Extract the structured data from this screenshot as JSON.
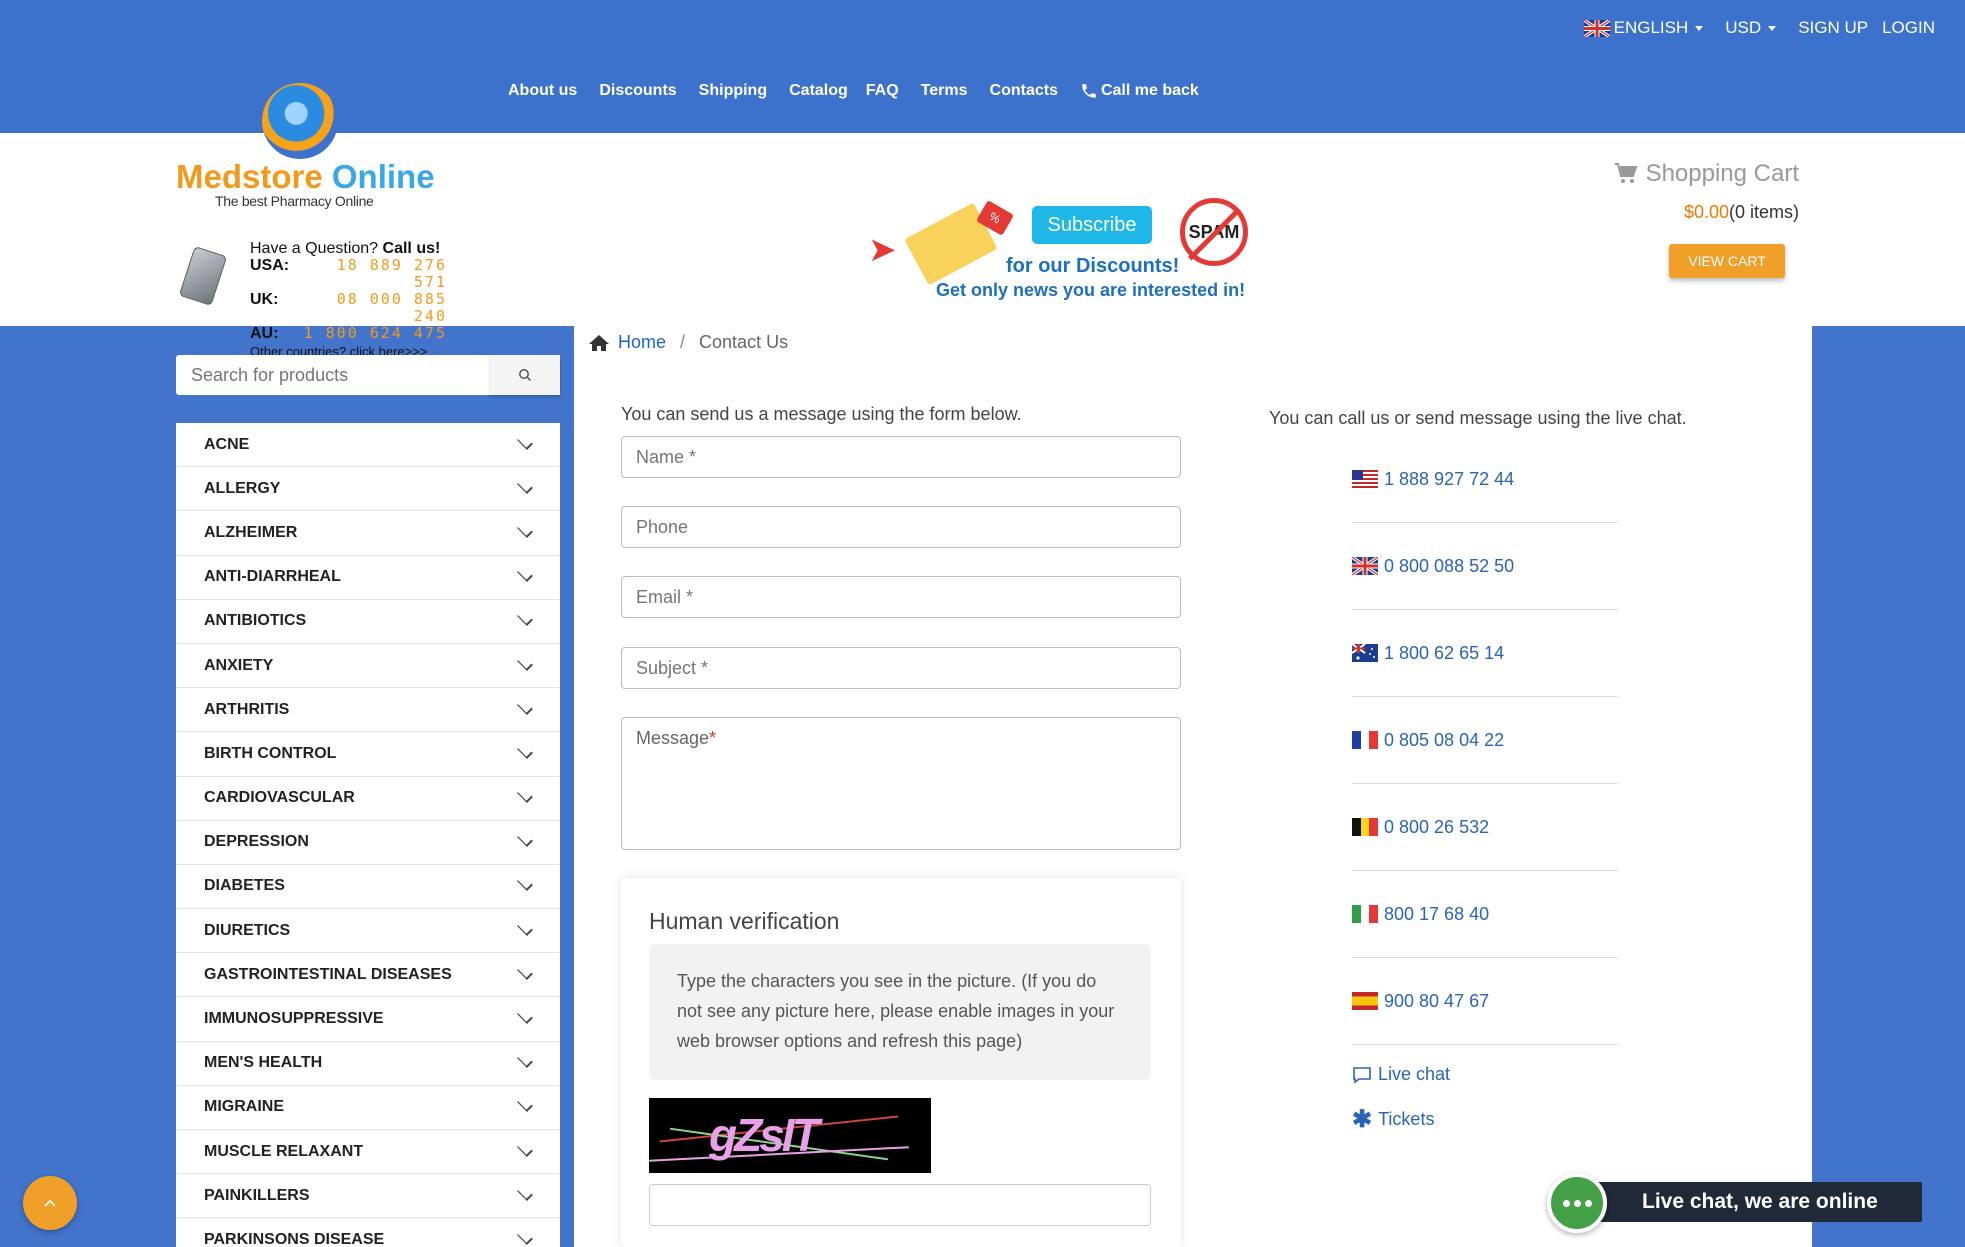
{
  "toplinks": {
    "language": "ENGLISH",
    "currency": "USD",
    "signup": "SIGN UP",
    "login": "LOGIN"
  },
  "nav": [
    "About us",
    "Discounts",
    "Shipping",
    "Catalog",
    "FAQ",
    "Terms",
    "Contacts",
    "Call me back"
  ],
  "logo": {
    "part1": "Medstore",
    "part2": "Online",
    "tagline": "The best Pharmacy Online"
  },
  "callus": {
    "question": "Have a Question?",
    "callus": "Call us!",
    "rows": [
      {
        "label": "USA:",
        "number": "18 889 276 571"
      },
      {
        "label": "UK:",
        "number": "08 000 885 240"
      },
      {
        "label": "AU:",
        "number": "1 800 624 475"
      }
    ],
    "other": "Other countries? click here>>>"
  },
  "subscribe": {
    "button": "Subscribe",
    "spam": "SPAM",
    "line1": "for our Discounts!",
    "line2": "Get only news you are interested in!",
    "tag": "%"
  },
  "cart": {
    "title": "Shopping Cart",
    "amount": "$0.00",
    "items": "(0 items)",
    "view": "VIEW CART"
  },
  "search": {
    "placeholder": "Search for products"
  },
  "categories": [
    "ACNE",
    "ALLERGY",
    "ALZHEIMER",
    "ANTI-DIARRHEAL",
    "ANTIBIOTICS",
    "ANXIETY",
    "ARTHRITIS",
    "BIRTH CONTROL",
    "CARDIOVASCULAR",
    "DEPRESSION",
    "DIABETES",
    "DIURETICS",
    "GASTROINTESTINAL DISEASES",
    "IMMUNOSUPPRESSIVE",
    "MEN'S HEALTH",
    "MIGRAINE",
    "MUSCLE RELAXANT",
    "PAINKILLERS",
    "PARKINSONS DISEASE"
  ],
  "breadcrumb": {
    "home": "Home",
    "separator": "/",
    "current": "Contact Us"
  },
  "form": {
    "intro": "You can send us a message using the form below.",
    "name": "Name *",
    "phone": "Phone",
    "email": "Email *",
    "subject": "Subject *",
    "message": "Message",
    "message_req": "*"
  },
  "verification": {
    "title": "Human verification",
    "note": "Type the characters you see in the picture. (If you do not see any picture here, please enable images in your web browser options and refresh this page)",
    "captcha": "gZsIT"
  },
  "contact": {
    "intro": "You can call us or send message using the live chat.",
    "phones": [
      {
        "country": "us",
        "number": "1 888 927 72 44"
      },
      {
        "country": "uk",
        "number": "0 800 088 52 50"
      },
      {
        "country": "au",
        "number": "1 800 62 65 14"
      },
      {
        "country": "fr",
        "number": "0 805 08 04 22"
      },
      {
        "country": "be",
        "number": "0 800 26 532"
      },
      {
        "country": "it",
        "number": "800 17 68 40"
      },
      {
        "country": "es",
        "number": "900 80 47 67"
      }
    ],
    "livechat": "Live chat",
    "tickets": "Tickets"
  },
  "chat_widget": {
    "label": "Live chat, we are online"
  },
  "colors": {
    "brand_blue": "#3d72cc",
    "orange": "#f0a028",
    "link": "#2a63b8",
    "chat_green": "#43a047"
  }
}
